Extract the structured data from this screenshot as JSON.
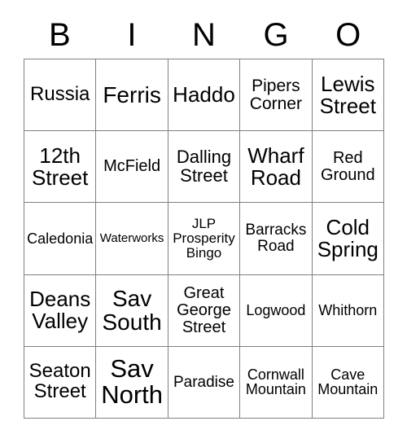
{
  "card": {
    "header_letters": [
      "B",
      "I",
      "N",
      "G",
      "O"
    ],
    "border_color": "#808080",
    "background_color": "#ffffff",
    "text_color": "#000000",
    "rows": [
      [
        {
          "text": "Russia",
          "size": "fs-24"
        },
        {
          "text": "Ferris",
          "size": "fs-28"
        },
        {
          "text": "Haddo",
          "size": "fs-26"
        },
        {
          "text": "Pipers\nCorner",
          "size": "fs-21"
        },
        {
          "text": "Lewis\nStreet",
          "size": "fs-26"
        }
      ],
      [
        {
          "text": "12th\nStreet",
          "size": "fs-26"
        },
        {
          "text": "McField",
          "size": "fs-20"
        },
        {
          "text": "Dalling\nStreet",
          "size": "fs-22"
        },
        {
          "text": "Wharf\nRoad",
          "size": "fs-26"
        },
        {
          "text": "Red\nGround",
          "size": "fs-20"
        }
      ],
      [
        {
          "text": "Caledonia",
          "size": "fs-18"
        },
        {
          "text": "Waterworks",
          "size": "fs-15"
        },
        {
          "text": "JLP\nProsperity\nBingo",
          "size": "fs-17"
        },
        {
          "text": "Barracks\nRoad",
          "size": "fs-19"
        },
        {
          "text": "Cold\nSpring",
          "size": "fs-26"
        }
      ],
      [
        {
          "text": "Deans\nValley",
          "size": "fs-26"
        },
        {
          "text": "Sav\nSouth",
          "size": "fs-28"
        },
        {
          "text": "Great\nGeorge\nStreet",
          "size": "fs-20"
        },
        {
          "text": "Logwood",
          "size": "fs-18"
        },
        {
          "text": "Whithorn",
          "size": "fs-18"
        }
      ],
      [
        {
          "text": "Seaton\nStreet",
          "size": "fs-24"
        },
        {
          "text": "Sav\nNorth",
          "size": "fs-31"
        },
        {
          "text": "Paradise",
          "size": "fs-19"
        },
        {
          "text": "Cornwall\nMountain",
          "size": "fs-18"
        },
        {
          "text": "Cave\nMountain",
          "size": "fs-18"
        }
      ]
    ]
  }
}
